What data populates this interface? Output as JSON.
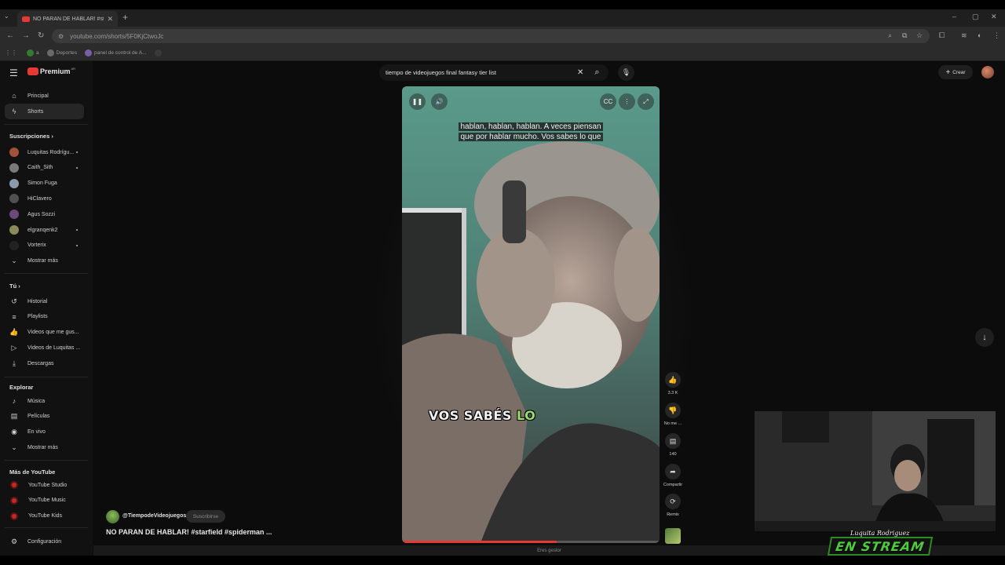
{
  "browser": {
    "tab_title": "NO PARAN DE HABLAR! #starfield",
    "url": "youtube.com/shorts/5F0KjCtwoJc",
    "bookmarks": [
      {
        "label": "a",
        "color": "#2e7d32"
      },
      {
        "label": "Deportes",
        "color": "#6a6a6a"
      },
      {
        "label": "panel de control de A...",
        "color": "#7b5ea8"
      },
      {
        "label": "",
        "color": "#3a3a3a"
      }
    ]
  },
  "youtube": {
    "logo_text": "Premium",
    "logo_region": "AR",
    "search_value": "tiempo de videojuegos final fantasy tier list",
    "create_label": "Crear"
  },
  "sidebar": {
    "main": [
      {
        "label": "Principal",
        "icon": "home-icon",
        "glyph": "⌂"
      },
      {
        "label": "Shorts",
        "icon": "shorts-icon",
        "glyph": "ϟ"
      }
    ],
    "subscriptions_heading": "Suscripciones",
    "subscriptions": [
      {
        "label": "Luquitas Rodrígu...",
        "color": "#a0523a",
        "live": true
      },
      {
        "label": "Caith_Sith",
        "color": "#7a7a7a",
        "live": true
      },
      {
        "label": "Simon Fuga",
        "color": "#8a9aa8",
        "live": false
      },
      {
        "label": "HiClavero",
        "color": "#505050",
        "live": false
      },
      {
        "label": "Agus Sozzi",
        "color": "#6a4a7a",
        "live": false
      },
      {
        "label": "elgranqenk2",
        "color": "#8a8a5a",
        "live": true
      },
      {
        "label": "Vorterix",
        "color": "#222222",
        "live": true
      }
    ],
    "show_more": "Mostrar más",
    "you_heading": "Tú",
    "you": [
      {
        "label": "Historial",
        "icon": "history-icon",
        "glyph": "↺"
      },
      {
        "label": "Playlists",
        "icon": "playlists-icon",
        "glyph": "≡"
      },
      {
        "label": "Videos que me gus...",
        "icon": "thumbs-up-icon",
        "glyph": "👍"
      },
      {
        "label": "Videos de Luquitas ...",
        "icon": "your-videos-icon",
        "glyph": "▷"
      },
      {
        "label": "Descargas",
        "icon": "download-icon",
        "glyph": "⤓"
      }
    ],
    "explore_heading": "Explorar",
    "explore": [
      {
        "label": "Música",
        "icon": "music-icon",
        "glyph": "♪"
      },
      {
        "label": "Películas",
        "icon": "movies-icon",
        "glyph": "▤"
      },
      {
        "label": "En vivo",
        "icon": "live-icon",
        "glyph": "◉"
      }
    ],
    "show_more_2": "Mostrar más",
    "more_heading": "Más de YouTube",
    "more": [
      {
        "label": "YouTube Studio"
      },
      {
        "label": "YouTube Music"
      },
      {
        "label": "YouTube Kids"
      }
    ],
    "settings": "Configuración"
  },
  "short": {
    "caption_line1": "hablan, hablan, hablan. A veces piensan",
    "caption_line2": "que por hablar mucho. Vos sabes lo que",
    "burned_text": "VOS SABÉS",
    "burned_highlight": "LO",
    "progress_fraction": 0.6,
    "likes": "3.3 K",
    "dislike_label": "No me ...",
    "comments": "140",
    "share_label": "Compartir",
    "remix_label": "Remix",
    "channel": "@TiempodeVideojuegos",
    "subscribe_label": "Suscribirse",
    "title": "NO PARAN DE HABLAR! #starfield #spiderman ..."
  },
  "status_text": "Eres gestor",
  "overlay": {
    "streamer_name": "Luquita Rodriguez",
    "badge_text": "EN STREAM"
  }
}
